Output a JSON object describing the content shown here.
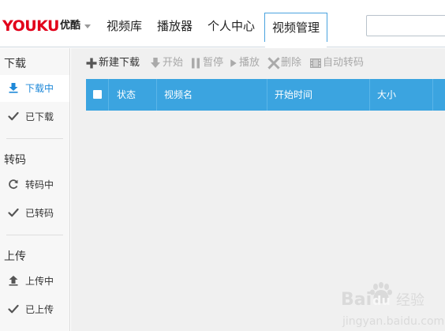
{
  "app": {
    "logo_text": "YOUKU",
    "logo_cn": "优酷"
  },
  "nav": {
    "items": [
      {
        "label": "视频库"
      },
      {
        "label": "播放器"
      },
      {
        "label": "个人中心"
      },
      {
        "label": "视频管理"
      }
    ],
    "active_index": 3
  },
  "search": {
    "value": "",
    "placeholder": ""
  },
  "sidebar": {
    "sections": [
      {
        "title": "下载",
        "items": [
          {
            "label": "下载中",
            "icon": "download-arrow-icon",
            "active": true
          },
          {
            "label": "已下载",
            "icon": "checkmark-icon",
            "active": false
          }
        ]
      },
      {
        "title": "转码",
        "items": [
          {
            "label": "转码中",
            "icon": "refresh-icon",
            "active": false
          },
          {
            "label": "已转码",
            "icon": "checkmark-icon",
            "active": false
          }
        ]
      },
      {
        "title": "上传",
        "items": [
          {
            "label": "上传中",
            "icon": "upload-arrow-icon",
            "active": false
          },
          {
            "label": "已上传",
            "icon": "checkmark-icon",
            "active": false
          }
        ]
      }
    ]
  },
  "toolbar": {
    "new_download": "新建下载",
    "start": "开始",
    "pause": "暂停",
    "play": "播放",
    "delete": "删除",
    "auto_transcode": "自动转码"
  },
  "table": {
    "columns": [
      "状态",
      "视频名",
      "开始时间",
      "大小"
    ]
  },
  "watermark": {
    "text_bai": "Bai",
    "text_du": "du",
    "text_cn": "经验",
    "url": "jingyan.baidu.com"
  },
  "colors": {
    "accent": "#3ba4e0",
    "logo_red": "#e2001a",
    "active_text": "#1e88d8",
    "disabled_text": "#a8a8a8"
  }
}
